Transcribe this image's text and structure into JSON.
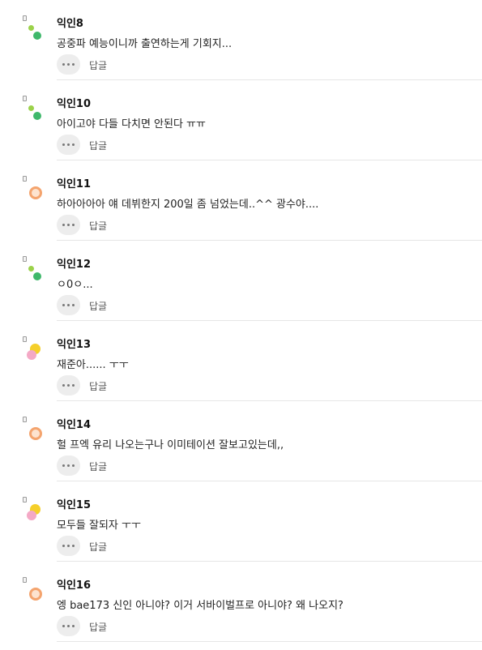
{
  "comments": [
    {
      "avatar": "green-dots",
      "nick": "익인8",
      "text": "공중파 예능이니까 출연하는게 기회지...",
      "reply": "답글"
    },
    {
      "avatar": "green-dots",
      "nick": "익인10",
      "text": "아이고야 다들 다치면 안된다 ㅠㅠ",
      "reply": "답글"
    },
    {
      "avatar": "orange-ring",
      "nick": "익인11",
      "text": "하아아아아 얘 데뷔한지 200일 좀 넘었는데..^^ 광수야....",
      "reply": "답글"
    },
    {
      "avatar": "green-dots",
      "nick": "익인12",
      "text": "ㅇ0ㅇ...",
      "reply": "답글"
    },
    {
      "avatar": "yellow-pink",
      "nick": "익인13",
      "text": "재준아...... ㅜㅜ",
      "reply": "답글"
    },
    {
      "avatar": "orange-ring",
      "nick": "익인14",
      "text": "헐 프엑 유리 나오는구나 이미테이션 잘보고있는데,,",
      "reply": "답글"
    },
    {
      "avatar": "yellow-pink",
      "nick": "익인15",
      "text": "모두들 잘되자 ㅜㅜ",
      "reply": "답글"
    },
    {
      "avatar": "orange-ring",
      "nick": "익인16",
      "text": "엥 bae173 신인 아니야? 이거 서바이벌프로 아니야? 왜 나오지?",
      "reply": "답글"
    }
  ],
  "colors": {
    "green_light": "#9bd24a",
    "green_dark": "#3fb86b",
    "orange": "#f4a46e",
    "orange_inner": "#fde3cf",
    "yellow": "#f5cf2a",
    "pink": "#f4a9c6"
  }
}
